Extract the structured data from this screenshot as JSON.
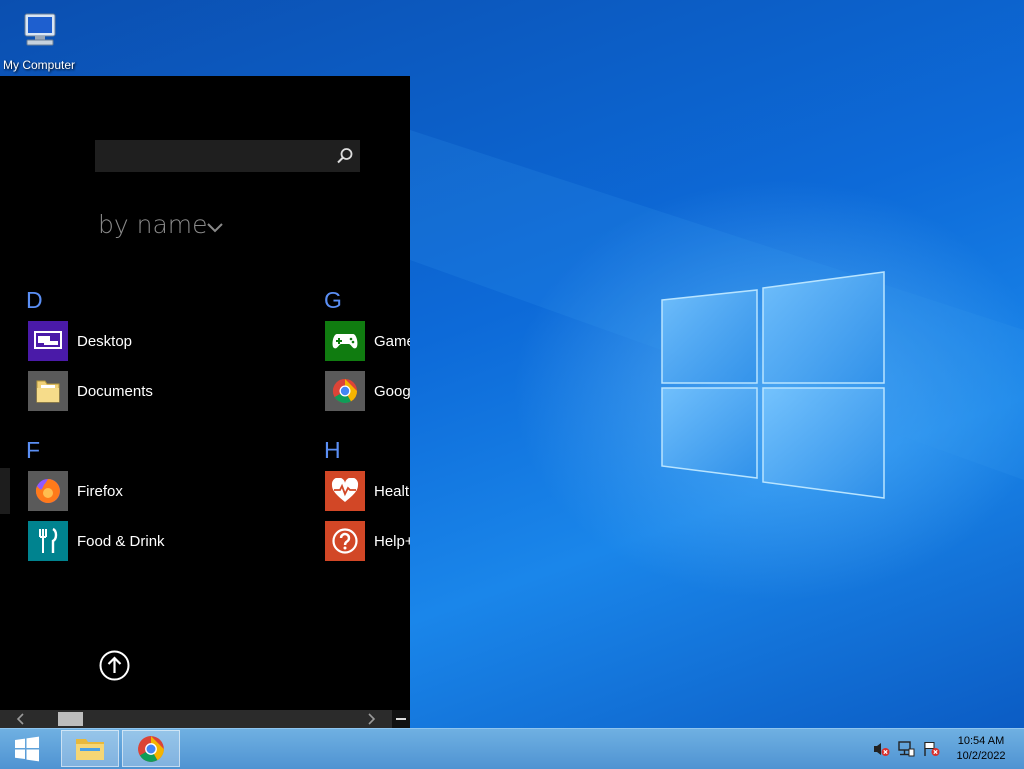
{
  "desktop": {
    "icons": [
      {
        "label": "My Computer",
        "icon": "computer-icon"
      }
    ]
  },
  "start_panel": {
    "search": {
      "value": "",
      "placeholder": "",
      "icon": "search-icon"
    },
    "sort_label": "by name",
    "groups": [
      {
        "letter": "D",
        "apps": [
          {
            "name": "Desktop",
            "icon": "desktop-app-icon",
            "color": "#4a1aa8"
          },
          {
            "name": "Documents",
            "icon": "folder-icon",
            "color": "#5a5a5a"
          }
        ]
      },
      {
        "letter": "F",
        "apps": [
          {
            "name": "Firefox",
            "icon": "firefox-icon",
            "color": "#5a5a5a"
          },
          {
            "name": "Food & Drink",
            "icon": "food-drink-icon",
            "color": "#00838f"
          }
        ]
      },
      {
        "letter": "G",
        "apps": [
          {
            "name": "Game",
            "icon": "games-icon",
            "color": "#107c10"
          },
          {
            "name": "Goog",
            "icon": "chrome-icon",
            "color": "#5a5a5a"
          }
        ]
      },
      {
        "letter": "H",
        "apps": [
          {
            "name": "Health",
            "icon": "health-icon",
            "color": "#d24726"
          },
          {
            "name": "Help+",
            "icon": "help-icon",
            "color": "#d24726"
          }
        ]
      }
    ]
  },
  "taskbar": {
    "apps": [
      {
        "icon": "file-explorer-icon"
      },
      {
        "icon": "chrome-icon"
      }
    ],
    "tray": [
      {
        "icon": "volume-muted-icon"
      },
      {
        "icon": "network-icon"
      },
      {
        "icon": "action-center-flag-icon"
      }
    ],
    "clock": {
      "time": "10:54 AM",
      "date": "10/2/2022"
    }
  },
  "colors": {
    "accent": "#5b8ff5",
    "panel_bg": "#000000",
    "taskbar": "#5fa3dc"
  }
}
